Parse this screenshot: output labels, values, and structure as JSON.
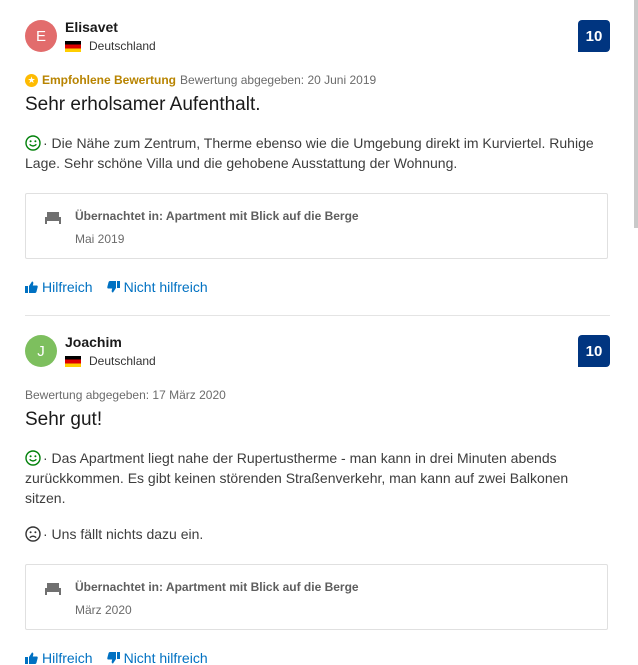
{
  "reviews": [
    {
      "avatar_letter": "E",
      "avatar_color": "#e26c6c",
      "name": "Elisavet",
      "country": "Deutschland",
      "score": "10",
      "recommended_label": "Empfohlene Bewertung",
      "date": "Bewertung abgegeben: 20 Juni 2019",
      "title": "Sehr erholsamer Aufenthalt.",
      "positive": "· Die Nähe zum Zentrum, Therme ebenso wie die Umgebung direkt im Kurviertel. Ruhige Lage. Sehr schöne Villa und die gehobene Ausstattung der Wohnung.",
      "stay_room": "Übernachtet in: Apartment mit Blick auf die Berge",
      "stay_date": "Mai 2019",
      "helpful_label": "Hilfreich",
      "not_helpful_label": "Nicht hilfreich"
    },
    {
      "avatar_letter": "J",
      "avatar_color": "#7dbf5e",
      "name": "Joachim",
      "country": "Deutschland",
      "score": "10",
      "date": "Bewertung abgegeben: 17 März 2020",
      "title": "Sehr gut!",
      "positive": "· Das Apartment liegt nahe der Rupertustherme - man kann in drei Minuten abends zurückkommen. Es gibt keinen störenden Straßenverkehr, man kann auf zwei Balkonen sitzen.",
      "negative": "· Uns fällt nichts dazu ein.",
      "stay_room": "Übernachtet in: Apartment mit Blick auf die Berge",
      "stay_date": "März 2020",
      "helpful_label": "Hilfreich",
      "not_helpful_label": "Nicht hilfreich"
    }
  ],
  "icons": {
    "positive": "smiling-face-icon",
    "negative": "sad-face-icon",
    "stay": "bed-icon",
    "helpful": "thumbs-up-icon",
    "not_helpful": "thumbs-down-icon",
    "recommended": "star-badge-icon"
  },
  "colors": {
    "score_bg": "#003580",
    "link": "#0071c2",
    "recommended": "#febb02",
    "positive": "#008009"
  }
}
